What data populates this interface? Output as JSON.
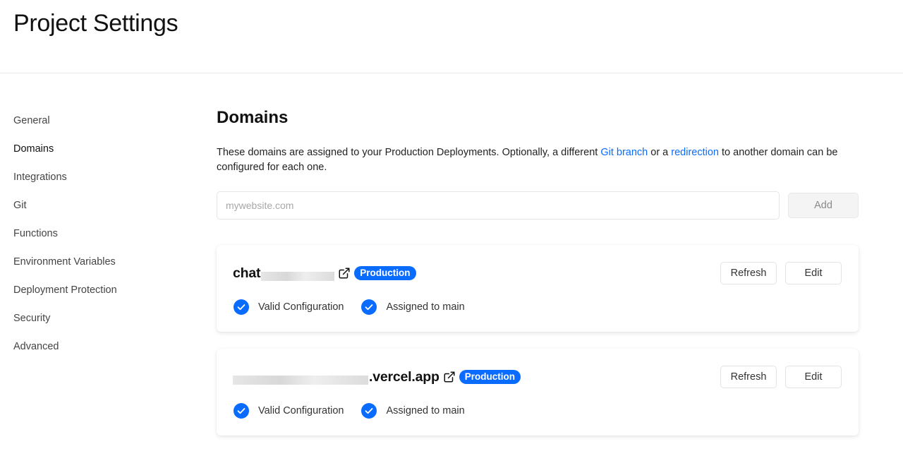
{
  "header": {
    "title": "Project Settings"
  },
  "sidebar": {
    "items": [
      {
        "label": "General",
        "active": false
      },
      {
        "label": "Domains",
        "active": true
      },
      {
        "label": "Integrations",
        "active": false
      },
      {
        "label": "Git",
        "active": false
      },
      {
        "label": "Functions",
        "active": false
      },
      {
        "label": "Environment Variables",
        "active": false
      },
      {
        "label": "Deployment Protection",
        "active": false
      },
      {
        "label": "Security",
        "active": false
      },
      {
        "label": "Advanced",
        "active": false
      }
    ]
  },
  "main": {
    "title": "Domains",
    "description": {
      "part1": "These domains are assigned to your Production Deployments. Optionally, a different ",
      "link1": "Git branch",
      "part2": " or a ",
      "link2": "redirection",
      "part3": " to another domain can be configured for each one."
    },
    "add_domain": {
      "placeholder": "mywebsite.com",
      "value": "",
      "button_label": "Add"
    },
    "domains": [
      {
        "name_prefix": "chat",
        "name_suffix": "",
        "badge": "Production",
        "refresh_label": "Refresh",
        "edit_label": "Edit",
        "statuses": [
          "Valid Configuration",
          "Assigned to main"
        ]
      },
      {
        "name_prefix": "",
        "name_suffix": ".vercel.app",
        "badge": "Production",
        "refresh_label": "Refresh",
        "edit_label": "Edit",
        "statuses": [
          "Valid Configuration",
          "Assigned to main"
        ]
      }
    ]
  },
  "icons": {
    "external_link": "external-link-icon",
    "check": "check-circle-icon"
  },
  "colors": {
    "accent": "#0a6cff",
    "border": "#eaeaea",
    "text": "#111111",
    "muted": "#444444"
  }
}
